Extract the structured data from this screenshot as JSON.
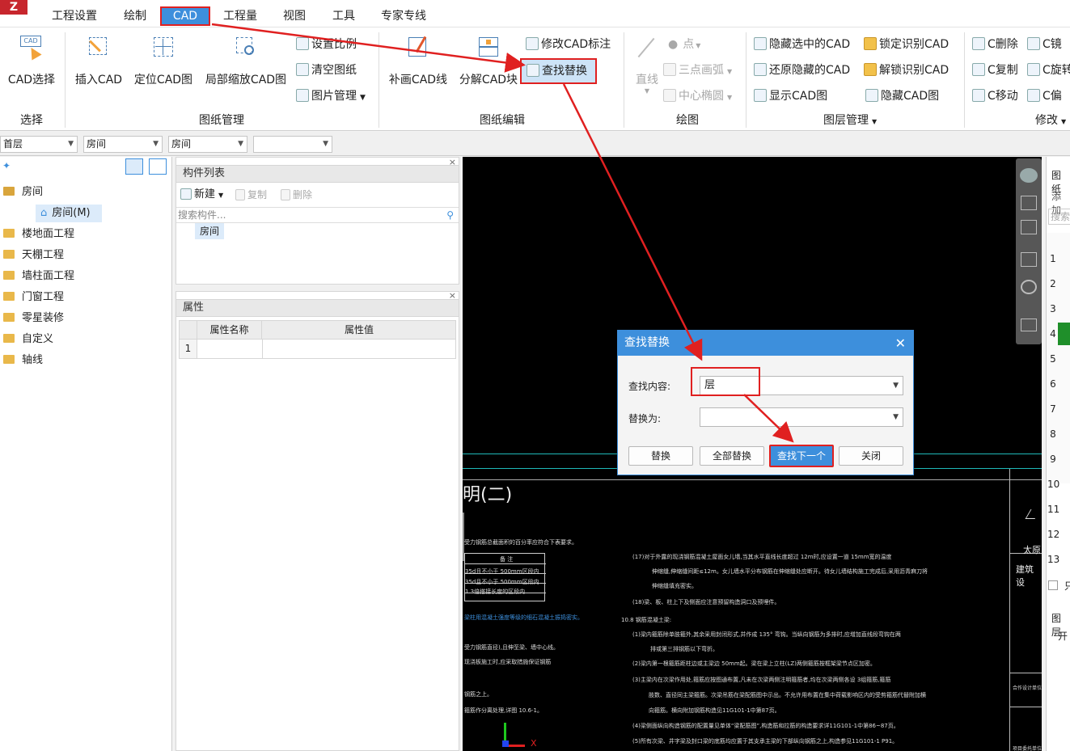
{
  "app": {
    "logo": "Z"
  },
  "menu": {
    "items": [
      "工程设置",
      "绘制",
      "CAD",
      "工程量",
      "视图",
      "工具",
      "专家专线"
    ],
    "active": "CAD"
  },
  "ribbon": {
    "select_group": {
      "title": "选择",
      "cad_select": "CAD选择",
      "cad_icon_text": "CAD"
    },
    "drawing_group": {
      "title": "图纸管理",
      "insert_cad": "插入CAD",
      "locate_cad": "定位CAD图",
      "zoom_cad": "局部缩放CAD图",
      "set_scale": "设置比例",
      "clear_drawing": "清空图纸",
      "image_manage": "图片管理"
    },
    "edit_group": {
      "title": "图纸编辑",
      "patch_line": "补画CAD线",
      "explode_block": "分解CAD块",
      "modify_dim": "修改CAD标注",
      "find_replace": "查找替换"
    },
    "draw_group": {
      "title": "绘图",
      "line": "直线",
      "point": "点",
      "arc": "三点画弧",
      "ellipse": "中心椭圆"
    },
    "layer_group": {
      "title": "图层管理",
      "hide_selected": "隐藏选中的CAD",
      "lock_identified": "锁定识别CAD",
      "restore_hidden": "还原隐藏的CAD",
      "unlock_identified": "解锁识别CAD",
      "show_cad": "显示CAD图",
      "hide_cad": "隐藏CAD图"
    },
    "modify_group": {
      "title": "修改",
      "delete": "C删除",
      "mirror": "C镜",
      "copy": "C复制",
      "rotate": "C旋转",
      "move": "C移动",
      "offset": "C偏"
    }
  },
  "filters": {
    "floor": "首层",
    "category": "房间",
    "type": "房间",
    "extra": ""
  },
  "tree": {
    "items": [
      "房间",
      "房间(M)",
      "楼地面工程",
      "天棚工程",
      "墙柱面工程",
      "门窗工程",
      "零星装修",
      "自定义",
      "轴线"
    ]
  },
  "components": {
    "title": "构件列表",
    "new": "新建",
    "copy": "复制",
    "delete": "删除",
    "search_placeholder": "搜索构件...",
    "items": [
      "房间"
    ]
  },
  "properties": {
    "title": "属性",
    "col_name": "属性名称",
    "col_value": "属性值",
    "row1": "1"
  },
  "cad": {
    "heading": "明(二)",
    "left_lines": [
      "受力钢筋总截面积的百分率应符合下表要求。",
      "备 注",
      "35d且不小于 500mm区段内",
      "35d且不小于 500mm区段内",
      "1.3倍搭接长度的区段内",
      "梁柱用混凝土强度等级的细石混凝土振捣密实。",
      "受力钢筋直径),且伸至梁、墙中心线。",
      "现浇板施工时,应采取措施保证钢筋",
      "钢筋之上。",
      "箍筋作分离处理,详图 10.6-1。"
    ],
    "right_lines": [
      "(17)对于外露的现浇钢筋混凝土屋面女儿墙,当其水平直线长度超过 12m时,应设置一道 15mm宽的温度",
      "伸缩缝,伸缩缝间距≤12m。女儿墙水平分布钢筋在伸缩缝处应断开。待女儿墙结构施工完成后,采用沥青麻刀将",
      "伸缩缝填充密实。",
      "(18)梁、板、柱上下及侧面应注意预留构造洞口及预埋件。",
      "10.8 钢筋混凝土梁:",
      "(1)梁内箍筋除单肢箍外,其余采用封闭形式,并作成 135° 弯钩。当纵向钢筋为多排时,应增加直线段弯钩在两",
      "排或第三排钢筋以下弯折。",
      "(2)梁内第一根箍筋距柱边或主梁边 50mm起。梁在梁上立柱(LZ)两侧箍筋按框架梁节点区加密。",
      "(3)主梁内在次梁作用处,箍筋应按图通布置,凡未在次梁两侧注明箍筋者,均在次梁两侧各设 3组箍筋,箍筋",
      "肢数、直径同主梁箍筋。次梁吊筋在梁配筋图中示出。不允许用布置在集中荷载影响区内的受剪箍筋代替附加横",
      "向箍筋。横向附加钢筋构造见11G101-1中第87页。",
      "(4)梁侧面纵向构造钢筋的配置量见单体“梁配筋图”,构造筋和拉筋的构造要求详11G101-1中第86~87页。",
      "(5)所有次梁、井字梁及封口梁的底筋均应置于其支承主梁的下部纵向钢筋之上,构造参见11G101-1 P91。"
    ],
    "title_block": [
      "太原",
      "建筑设",
      "合作设计单位",
      "项目委托单位"
    ],
    "axis_x": "X"
  },
  "right_panel": {
    "tab": "图纸",
    "add": "添加",
    "search": "搜索",
    "rows": [
      "1",
      "2",
      "3",
      "4",
      "5",
      "6",
      "7",
      "8",
      "9",
      "10",
      "11",
      "12",
      "13"
    ],
    "layer_tab": "图层",
    "open": "开",
    "only": "只"
  },
  "dialog": {
    "title": "查找替换",
    "find_label": "查找内容:",
    "find_value": "层",
    "replace_label": "替换为:",
    "replace_value": "",
    "replace_btn": "替换",
    "replace_all_btn": "全部替换",
    "find_next_btn": "查找下一个",
    "close_btn": "关闭"
  },
  "colors": {
    "accent": "#3d8fdc",
    "highlight": "#e02020",
    "cad_bg": "#000000",
    "cyan_line": "#1fb8b8"
  }
}
